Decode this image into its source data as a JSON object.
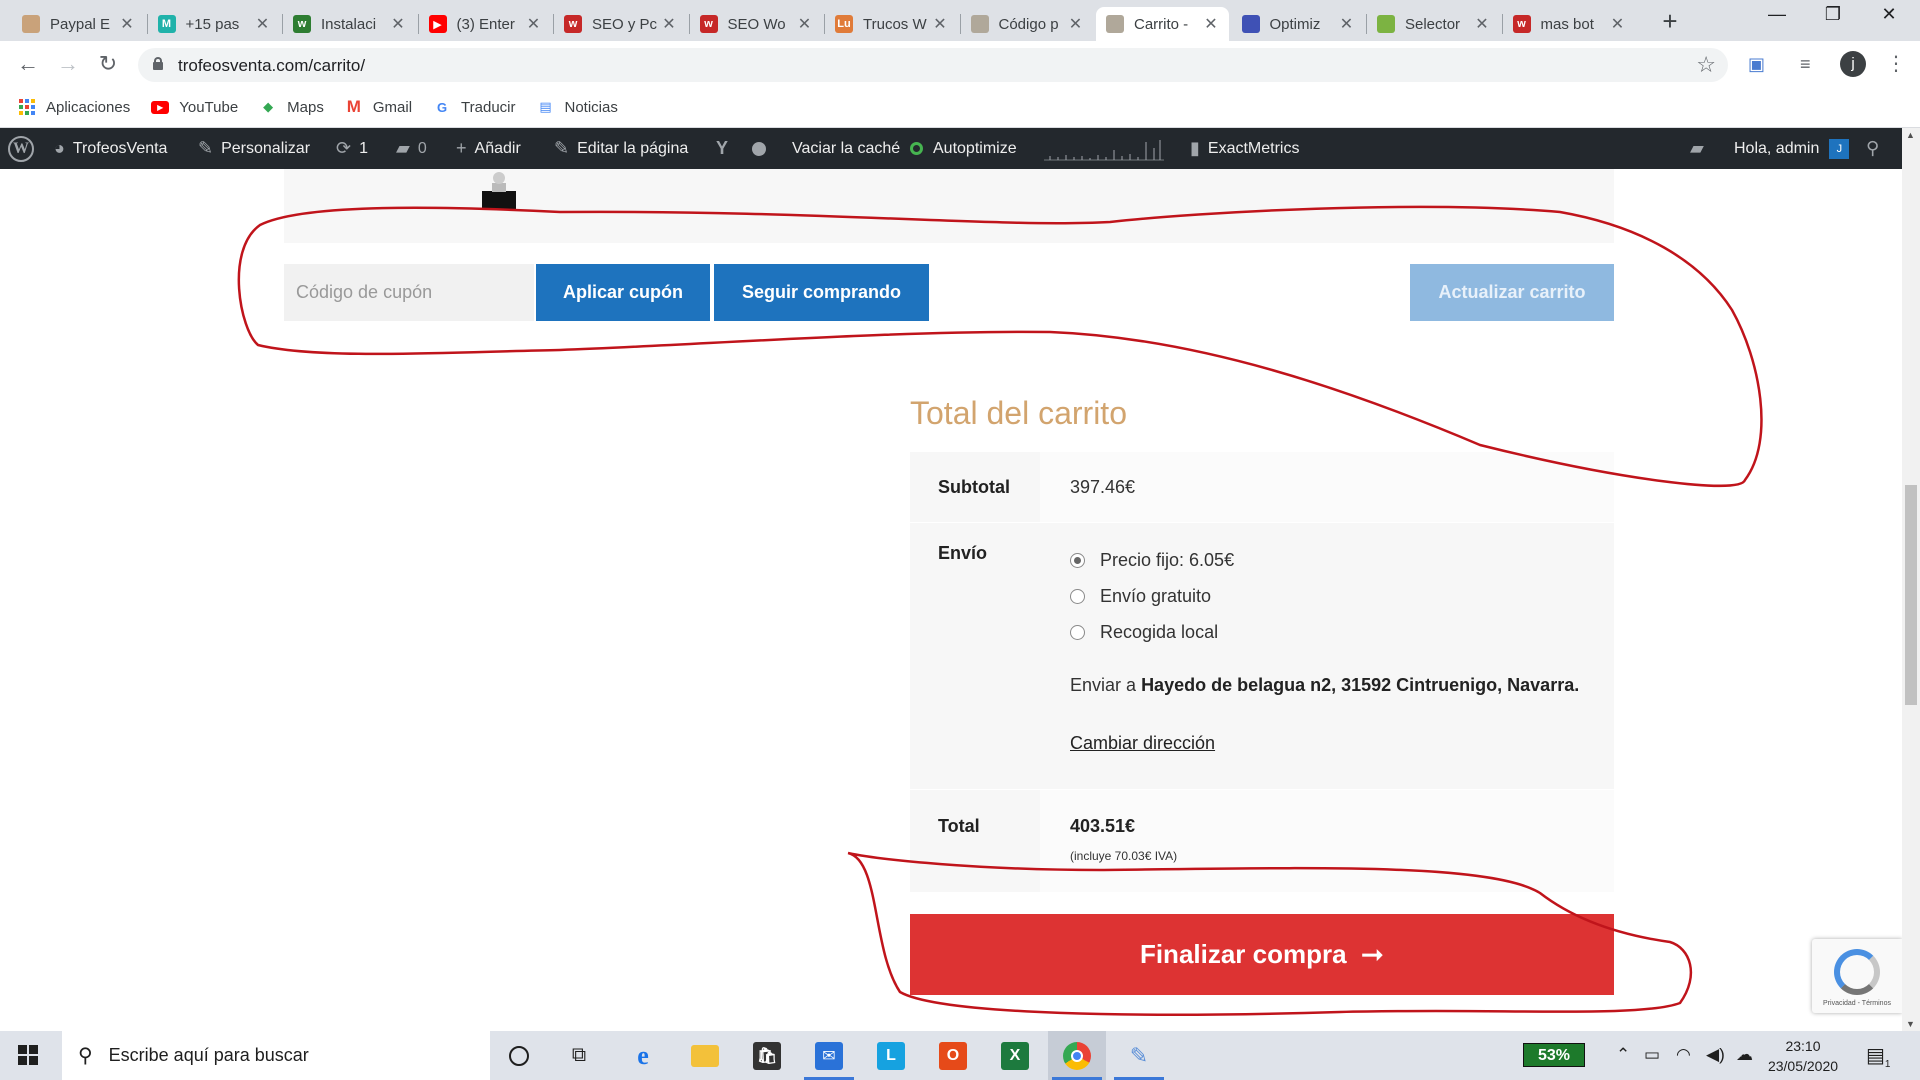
{
  "browser": {
    "tabs": [
      {
        "label": "Paypal E",
        "icon": "paypal-icon",
        "color": "#c9a27a",
        "letter": ""
      },
      {
        "label": "+15 pas",
        "icon": "site-icon",
        "color": "#20b2aa",
        "letter": "M"
      },
      {
        "label": "Instalaci",
        "icon": "woocommerce-icon",
        "color": "#2e7d32",
        "letter": "w"
      },
      {
        "label": "(3) Enter",
        "icon": "youtube-icon",
        "color": "#ff0000",
        "letter": "▶"
      },
      {
        "label": "SEO y Pc",
        "icon": "webempresa-icon",
        "color": "#c62828",
        "letter": "w"
      },
      {
        "label": "SEO Wo",
        "icon": "webempresa-icon",
        "color": "#c62828",
        "letter": "w"
      },
      {
        "label": "Trucos W",
        "icon": "trucos-icon",
        "color": "#e07b39",
        "letter": "Lu"
      },
      {
        "label": "Código p",
        "icon": "page-icon",
        "color": "#b0a89a",
        "letter": ""
      },
      {
        "label": "Carrito -",
        "icon": "page-icon",
        "color": "#b0a89a",
        "letter": ""
      },
      {
        "label": "Optimiz",
        "icon": "chart-icon",
        "color": "#3f51b5",
        "letter": ""
      },
      {
        "label": "Selector",
        "icon": "sheet-icon",
        "color": "#7cb342",
        "letter": ""
      },
      {
        "label": "mas bot",
        "icon": "webempresa-icon",
        "color": "#c62828",
        "letter": "w"
      }
    ],
    "active_tab_index": 8,
    "url": "trofeosventa.com/carrito/",
    "profile_initial": "j",
    "bookmarks": [
      {
        "label": "Aplicaciones",
        "icon": "apps-grid-icon"
      },
      {
        "label": "YouTube",
        "icon": "youtube-icon"
      },
      {
        "label": "Maps",
        "icon": "maps-icon"
      },
      {
        "label": "Gmail",
        "icon": "gmail-icon"
      },
      {
        "label": "Traducir",
        "icon": "translate-icon"
      },
      {
        "label": "Noticias",
        "icon": "news-icon"
      }
    ]
  },
  "adminbar": {
    "site": "TrofeosVenta",
    "customize": "Personalizar",
    "updates": "1",
    "comments": "0",
    "add_new": "Añadir",
    "edit_page": "Editar la página",
    "clear_cache": "Vaciar la caché",
    "autoptimize": "Autoptimize",
    "exactmetrics": "ExactMetrics",
    "greeting": "Hola, admin",
    "avatar_initial": "J"
  },
  "cart": {
    "coupon_placeholder": "Código de cupón",
    "apply_coupon": "Aplicar cupón",
    "continue_shopping": "Seguir comprando",
    "update_cart": "Actualizar carrito"
  },
  "totals": {
    "title": "Total del carrito",
    "subtotal_label": "Subtotal",
    "subtotal_value": "397.46€",
    "shipping_label": "Envío",
    "shipping_options": [
      {
        "label": "Precio fijo: 6.05€",
        "checked": true
      },
      {
        "label": "Envío gratuito",
        "checked": false
      },
      {
        "label": "Recogida local",
        "checked": false
      }
    ],
    "ship_to_prefix": "Enviar a",
    "ship_to_address": "Hayedo de belagua n2, 31592 Cintruenigo, Navarra.",
    "change_address": "Cambiar dirección",
    "total_label": "Total",
    "total_value": "403.51€",
    "tax_note": "(incluye 70.03€ IVA)"
  },
  "checkout": {
    "label": "Finalizar compra",
    "arrow": "➞"
  },
  "recaptcha": {
    "footer": "Privacidad - Términos"
  },
  "taskbar": {
    "search_placeholder": "Escribe aquí para buscar",
    "battery": "53%",
    "time": "23:10",
    "date": "23/05/2020",
    "apps": [
      {
        "name": "cortana-icon"
      },
      {
        "name": "task-view-icon"
      },
      {
        "name": "edge-icon"
      },
      {
        "name": "file-explorer-icon"
      },
      {
        "name": "store-icon"
      },
      {
        "name": "mail-icon"
      },
      {
        "name": "launcher-l-icon"
      },
      {
        "name": "office-icon"
      },
      {
        "name": "excel-icon"
      },
      {
        "name": "chrome-icon"
      },
      {
        "name": "paint-icon"
      }
    ],
    "notification_count": "1"
  },
  "colors": {
    "blue_button": "#1e73be",
    "update_button": "#8fb9e0",
    "checkout_button": "#dd3333",
    "totals_title": "#d2a46e",
    "annotation_red": "#c0141b"
  }
}
